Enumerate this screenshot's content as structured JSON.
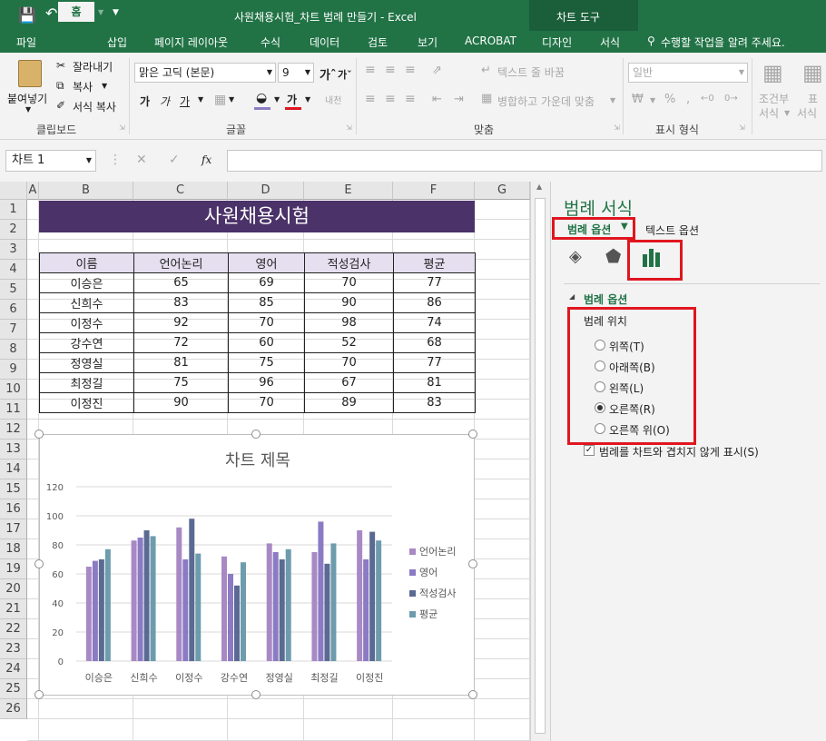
{
  "app": {
    "window_title": "사원채용시험_차트 범례 만들기 - Excel",
    "context_tool_label": "차트 도구",
    "tabs": [
      "파일",
      "홈",
      "삽입",
      "페이지 레이아웃",
      "수식",
      "데이터",
      "검토",
      "보기",
      "ACROBAT",
      "디자인",
      "서식"
    ],
    "tell_me": "수행할 작업을 알려 주세요."
  },
  "ribbon": {
    "paste": "붙여넣기",
    "cut": "잘라내기",
    "copy": "복사",
    "format_painter": "서식 복사",
    "font_name": "맑은 고딕 (본문)",
    "font_size": "9",
    "wrap_text": "텍스트 줄 바꿈",
    "merge_center": "병합하고 가운데 맞춤",
    "number_format": "일반",
    "cond_format_1": "조건부",
    "cond_format_2": "서식",
    "table_format_1": "표",
    "table_format_2": "서식",
    "groups": {
      "clipboard": "클립보드",
      "font": "글꼴",
      "alignment": "맞춤",
      "number": "표시 형식"
    }
  },
  "formula_bar": {
    "name_box": "차트 1",
    "fx": "fx",
    "value": ""
  },
  "sheet": {
    "columns": [
      "A",
      "B",
      "C",
      "D",
      "E",
      "F",
      "G"
    ],
    "rows": [
      "1",
      "2",
      "3",
      "4",
      "5",
      "6",
      "7",
      "8",
      "9",
      "10",
      "11",
      "12",
      "13",
      "14",
      "15",
      "16",
      "17",
      "18",
      "19",
      "20",
      "21",
      "22",
      "23",
      "24",
      "25",
      "26"
    ],
    "banner_title": "사원채용시험",
    "table_headers": [
      "이름",
      "언어논리",
      "영어",
      "적성검사",
      "평균"
    ],
    "table_rows": [
      [
        "이승은",
        "65",
        "69",
        "70",
        "77"
      ],
      [
        "신희수",
        "83",
        "85",
        "90",
        "86"
      ],
      [
        "이정수",
        "92",
        "70",
        "98",
        "74"
      ],
      [
        "강수연",
        "72",
        "60",
        "52",
        "68"
      ],
      [
        "정영실",
        "81",
        "75",
        "70",
        "77"
      ],
      [
        "최정길",
        "75",
        "96",
        "67",
        "81"
      ],
      [
        "이정진",
        "90",
        "70",
        "89",
        "83"
      ]
    ]
  },
  "chart_data": {
    "type": "bar",
    "title": "차트 제목",
    "categories": [
      "이승은",
      "신희수",
      "이정수",
      "강수연",
      "정영실",
      "최정길",
      "이정진"
    ],
    "series": [
      {
        "name": "언어논리",
        "values": [
          65,
          83,
          92,
          72,
          81,
          75,
          90
        ],
        "color": "#a889c4"
      },
      {
        "name": "영어",
        "values": [
          69,
          85,
          70,
          60,
          75,
          96,
          70
        ],
        "color": "#8b7ac4"
      },
      {
        "name": "적성검사",
        "values": [
          70,
          90,
          98,
          52,
          70,
          67,
          89
        ],
        "color": "#5b6a93"
      },
      {
        "name": "평균",
        "values": [
          77,
          86,
          74,
          68,
          77,
          81,
          83
        ],
        "color": "#6d9cad"
      }
    ],
    "y_ticks": [
      "0",
      "20",
      "40",
      "60",
      "80",
      "100",
      "120"
    ],
    "ylim": [
      0,
      120
    ],
    "grid": true,
    "legend_position": "right"
  },
  "pane": {
    "title": "범례 서식",
    "tab_legend_options": "범례 옵션",
    "tab_text_options": "텍스트 옵션",
    "section": "범례 옵션",
    "position_label": "범례 위치",
    "positions": [
      "위쪽(T)",
      "아래쪽(B)",
      "왼쪽(L)",
      "오른쪽(R)",
      "오른쪽 위(O)"
    ],
    "selected_position": "오른쪽(R)",
    "overlap_checkbox": "범례를 차트와 겹치지 않게 표시(S)",
    "overlap_checked": true
  },
  "colors": {
    "excel_green": "#217346",
    "banner": "#4b3269",
    "header_fill": "#e5dff0",
    "highlight": "#e0161f",
    "pane_title": "#217346"
  }
}
